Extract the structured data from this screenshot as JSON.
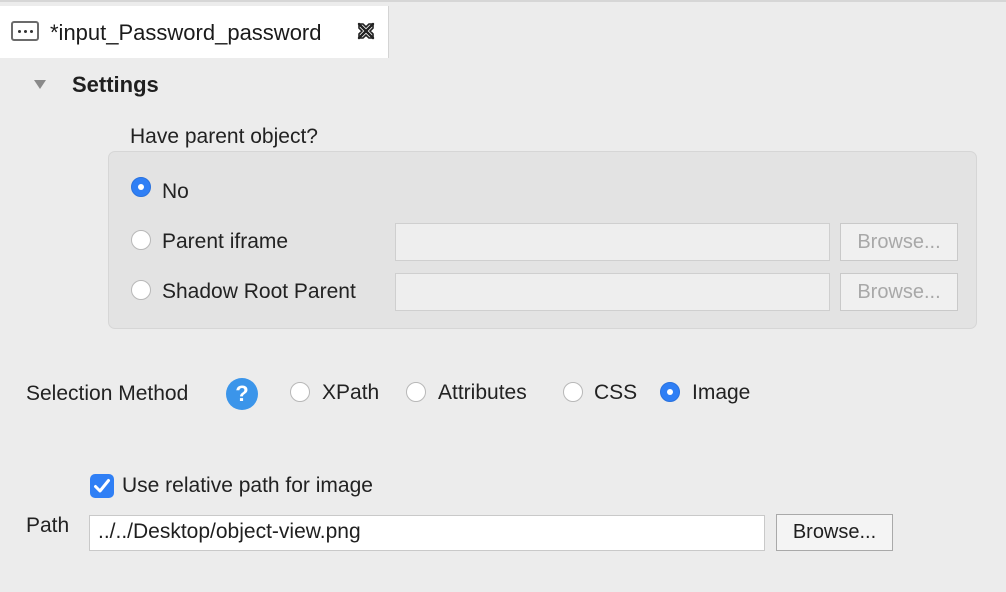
{
  "tab": {
    "title": "*input_Password_password",
    "icon": "object-icon",
    "close_icon": "close-icon"
  },
  "settings": {
    "title": "Settings",
    "parent_question": "Have parent object?",
    "parent_options": [
      {
        "label": "No",
        "selected": true
      },
      {
        "label": "Parent iframe",
        "selected": false,
        "value": "",
        "browse_label": "Browse...",
        "enabled": false
      },
      {
        "label": "Shadow Root Parent",
        "selected": false,
        "value": "",
        "browse_label": "Browse...",
        "enabled": false
      }
    ]
  },
  "selection": {
    "label": "Selection Method",
    "help_icon": "help-icon",
    "help_symbol": "?",
    "methods": [
      {
        "label": "XPath",
        "selected": false
      },
      {
        "label": "Attributes",
        "selected": false
      },
      {
        "label": "CSS",
        "selected": false
      },
      {
        "label": "Image",
        "selected": true
      }
    ]
  },
  "image": {
    "relative_checkbox_label": "Use relative path for image",
    "relative_checked": true,
    "path_label": "Path",
    "path_value": "../../Desktop/object-view.png",
    "browse_label": "Browse..."
  },
  "colors": {
    "accent": "#2f7ff5",
    "help": "#3b95ea",
    "panel_bg": "#ececec"
  }
}
